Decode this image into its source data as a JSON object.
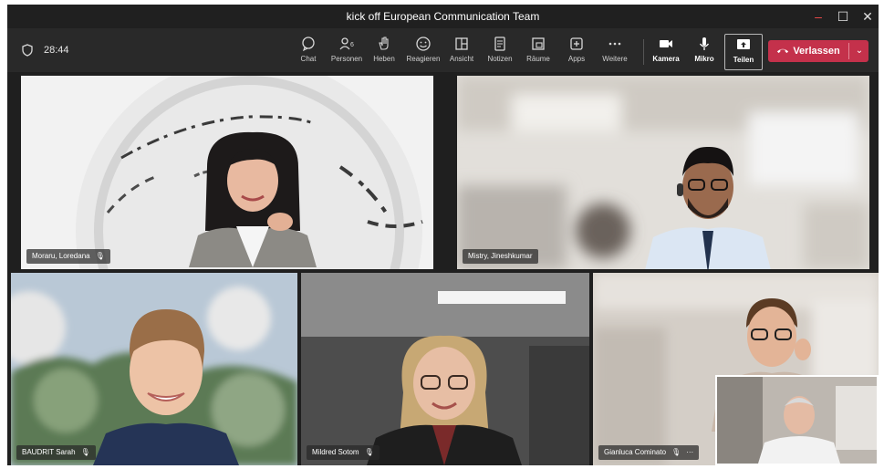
{
  "window": {
    "title": "kick off European Communication Team",
    "controls": {
      "minimize": "–",
      "maximize": "☐",
      "close": "✕"
    }
  },
  "toolbar": {
    "timer": "28:44",
    "items": [
      {
        "label": "Chat",
        "icon": "chat-icon"
      },
      {
        "label": "Personen",
        "icon": "people-icon",
        "count": "6"
      },
      {
        "label": "Heben",
        "icon": "raise-hand-icon"
      },
      {
        "label": "Reagieren",
        "icon": "react-icon"
      },
      {
        "label": "Ansicht",
        "icon": "view-icon"
      },
      {
        "label": "Notizen",
        "icon": "notes-icon"
      },
      {
        "label": "Räume",
        "icon": "rooms-icon"
      },
      {
        "label": "Apps",
        "icon": "apps-icon"
      },
      {
        "label": "Weitere",
        "icon": "more-icon"
      }
    ],
    "media": [
      {
        "label": "Kamera",
        "icon": "camera-icon"
      },
      {
        "label": "Mikro",
        "icon": "microphone-icon"
      },
      {
        "label": "Teilen",
        "icon": "share-icon"
      }
    ],
    "leave": {
      "label": "Verlassen",
      "color": "#c4314b"
    }
  },
  "participants": [
    {
      "name": "Moraru, Loredana",
      "muted": true
    },
    {
      "name": "Mistry, Jineshkumar",
      "muted": false
    },
    {
      "name": "BAUDRIT Sarah",
      "muted": true
    },
    {
      "name": "Mildred Sotom",
      "muted": true
    },
    {
      "name": "Gianluca Cominato",
      "muted": true,
      "more": "···"
    }
  ],
  "colors": {
    "accent": "#c4314b",
    "toolbar": "#292929",
    "background": "#1f1f1f"
  }
}
